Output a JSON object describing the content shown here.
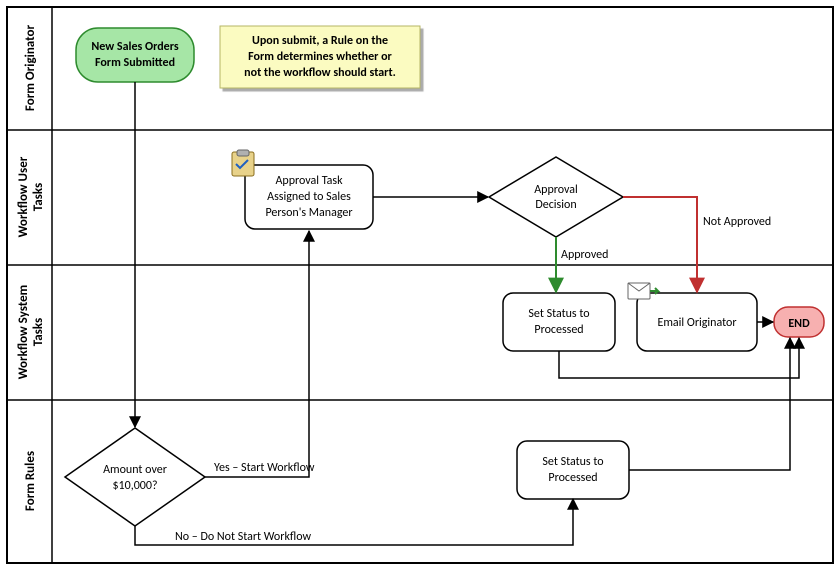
{
  "lanes": [
    {
      "label": "Form Originator"
    },
    {
      "label": "Workflow User Tasks"
    },
    {
      "label": "Workflow System Tasks"
    },
    {
      "label": "Form Rules"
    }
  ],
  "nodes": {
    "start": {
      "line1": "New Sales Orders",
      "line2": "Form Submitted"
    },
    "note": {
      "line1": "Upon submit, a Rule on the",
      "line2": "Form determines whether or",
      "line3": "not the workflow should start."
    },
    "approvalTask": {
      "line1": "Approval Task",
      "line2": "Assigned to Sales",
      "line3": "Person's Manager"
    },
    "approvalDecision": {
      "line1": "Approval",
      "line2": "Decision"
    },
    "setProcessed1": {
      "line1": "Set Status to",
      "line2": "Processed"
    },
    "emailOriginator": {
      "line1": "Email Originator"
    },
    "end": {
      "label": "END"
    },
    "amountDecision": {
      "line1": "Amount over",
      "line2": "$10,000?"
    },
    "setProcessed2": {
      "line1": "Set Status to",
      "line2": "Processed"
    }
  },
  "edges": {
    "approved": "Approved",
    "notApproved": "Not Approved",
    "yes": "Yes – Start Workflow",
    "no": "No – Do Not Start Workflow"
  }
}
